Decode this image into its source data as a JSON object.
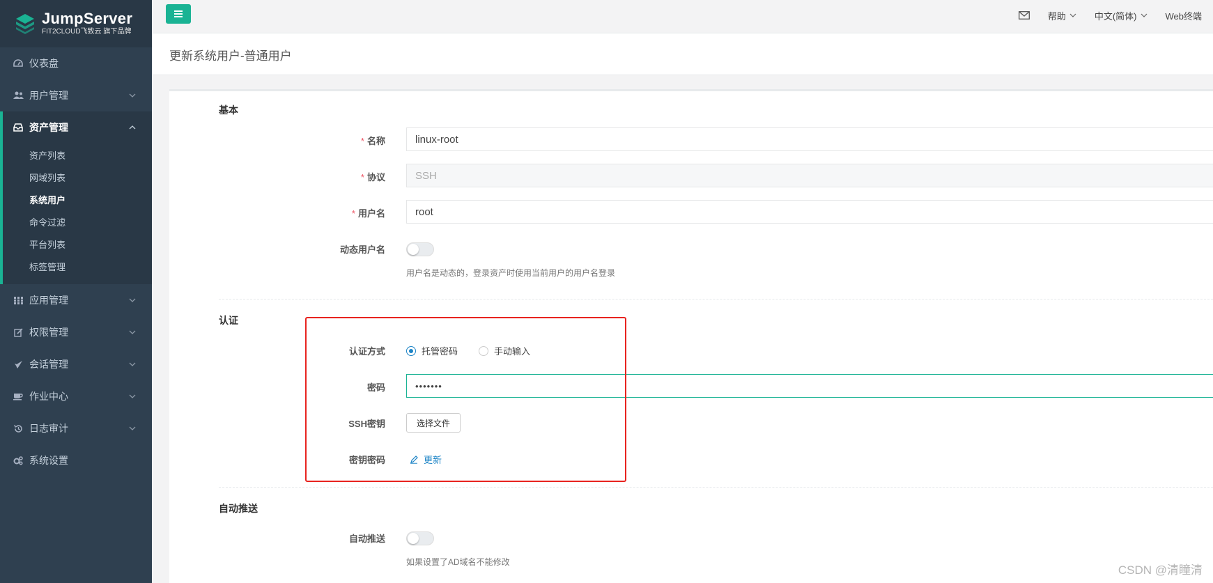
{
  "brand": {
    "name": "JumpServer",
    "subtitle": "FIT2CLOUD飞致云 旗下品牌",
    "color": "#1ab394"
  },
  "sidebar": {
    "items": [
      {
        "label": "仪表盘",
        "icon": "dashboard-icon"
      },
      {
        "label": "用户管理",
        "icon": "users-icon"
      },
      {
        "label": "资产管理",
        "icon": "inbox-icon",
        "expanded": true
      },
      {
        "label": "应用管理",
        "icon": "grid-icon"
      },
      {
        "label": "权限管理",
        "icon": "edit-icon"
      },
      {
        "label": "会话管理",
        "icon": "rocket-icon"
      },
      {
        "label": "作业中心",
        "icon": "coffee-icon"
      },
      {
        "label": "日志审计",
        "icon": "history-icon"
      },
      {
        "label": "系统设置",
        "icon": "gears-icon"
      }
    ],
    "asset_sub": [
      "资产列表",
      "网域列表",
      "系统用户",
      "命令过滤",
      "平台列表",
      "标签管理"
    ],
    "active_sub": "系统用户"
  },
  "topbar": {
    "help": "帮助",
    "language": "中文(简体)",
    "terminal": "Web终端"
  },
  "page": {
    "title": "更新系统用户-普通用户"
  },
  "form": {
    "basic_title": "基本",
    "name_label": "名称",
    "name_value": "linux-root",
    "protocol_label": "协议",
    "protocol_value": "SSH",
    "username_label": "用户名",
    "username_value": "root",
    "dynamic_label": "动态用户名",
    "dynamic_help": "用户名是动态的，登录资产时使用当前用户的用户名登录",
    "dynamic_on": false,
    "auth_title": "认证",
    "auth_method_label": "认证方式",
    "auth_options": [
      "托管密码",
      "手动输入"
    ],
    "auth_selected": "托管密码",
    "password_label": "密码",
    "password_value": "•••••••",
    "ssh_key_label": "SSH密钥",
    "choose_file": "选择文件",
    "key_password_label": "密钥密码",
    "update_link": "更新",
    "push_title": "自动推送",
    "push_label": "自动推送",
    "push_on": false,
    "push_help": "如果设置了AD域名不能修改"
  },
  "watermark": "CSDN @清瞳清"
}
